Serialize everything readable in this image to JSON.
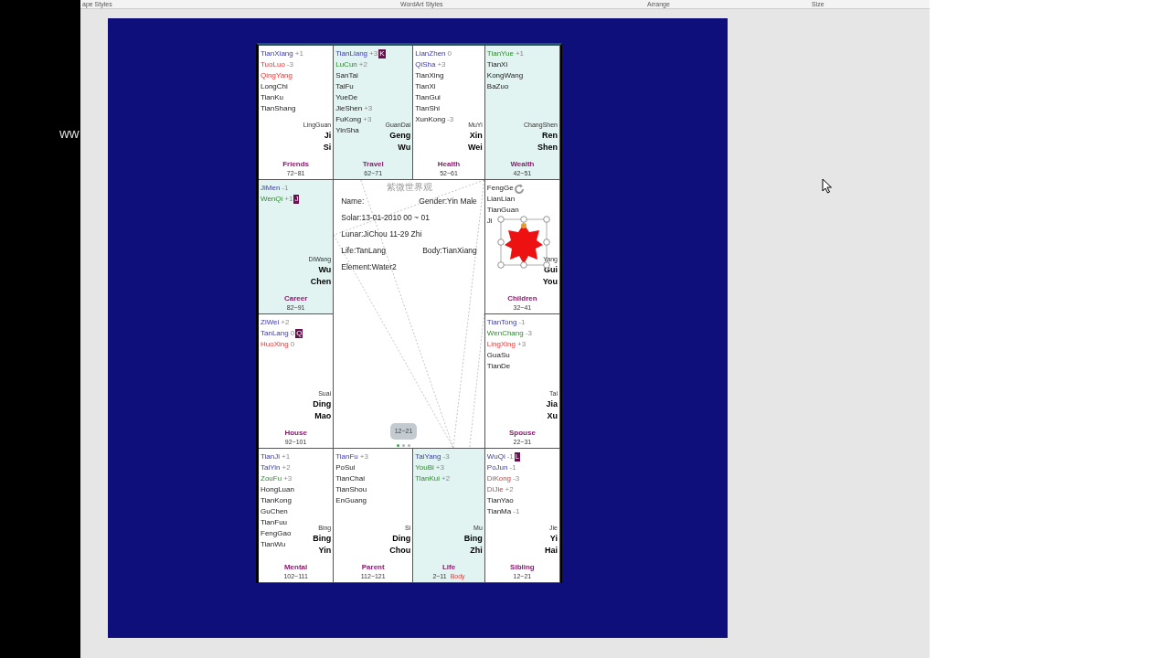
{
  "ribbon": {
    "groups": [
      "ape Styles",
      "WordArt Styles",
      "Arrange",
      "Size"
    ]
  },
  "side_text": "ww",
  "chart": {
    "title": "紫微世界观",
    "info": [
      {
        "label": "Name:",
        "value": "Gender:Yin Male"
      },
      {
        "label": "Solar:13-01-2010 00 ~ 01"
      },
      {
        "label": "Lunar:JiChou 11-29 Zhi"
      },
      {
        "label": "Life:TanLang",
        "value": "Body:TianXiang"
      },
      {
        "label": "Element:Water2"
      }
    ],
    "decade_badge": "12~21",
    "pager": [
      {
        "selected": true
      },
      {
        "selected": false
      },
      {
        "selected": false
      }
    ],
    "palaces": [
      {
        "name": "Friends",
        "ages": "72~81",
        "highlighted": false,
        "minor": "LingGuan",
        "stem": "Ji",
        "branch": "Si",
        "stars": [
          {
            "name": "TianXiang",
            "brightness": "+1",
            "kind": "major"
          },
          {
            "name": "TuoLuo",
            "brightness": "-3",
            "kind": "malefic"
          },
          {
            "name": "QingYang",
            "kind": "malefic"
          },
          {
            "name": "LongChi",
            "kind": "minor"
          },
          {
            "name": "TianKu",
            "kind": "minor"
          },
          {
            "name": "TianShang",
            "kind": "minor"
          }
        ]
      },
      {
        "name": "Travel",
        "ages": "62~71",
        "highlighted": true,
        "minor": "GuanDai",
        "stem": "Geng",
        "branch": "Wu",
        "stars": [
          {
            "name": "TianLiang",
            "brightness": "+3",
            "kind": "major",
            "tag": "K"
          },
          {
            "name": "LuCun",
            "brightness": "+2",
            "kind": "auxiliary"
          },
          {
            "name": "SanTai",
            "kind": "minor"
          },
          {
            "name": "TaiFu",
            "kind": "minor"
          },
          {
            "name": "YueDe",
            "kind": "minor"
          },
          {
            "name": "JieShen",
            "brightness": "+3",
            "kind": "minor"
          },
          {
            "name": "FuKong",
            "brightness": "+3",
            "kind": "minor"
          },
          {
            "name": "YinSha",
            "kind": "minor"
          }
        ]
      },
      {
        "name": "Health",
        "ages": "52~61",
        "highlighted": false,
        "minor": "MuYi",
        "stem": "Xin",
        "branch": "Wei",
        "stars": [
          {
            "name": "LianZhen",
            "brightness": "0",
            "kind": "major"
          },
          {
            "name": "QiSha",
            "brightness": "+3",
            "kind": "major"
          },
          {
            "name": "TianXing",
            "kind": "minor"
          },
          {
            "name": "TianXi",
            "kind": "minor"
          },
          {
            "name": "TianGui",
            "kind": "minor"
          },
          {
            "name": "TianShi",
            "kind": "minor"
          },
          {
            "name": "XunKong",
            "brightness": "-3",
            "kind": "minor"
          }
        ]
      },
      {
        "name": "Wealth",
        "ages": "42~51",
        "highlighted": true,
        "minor": "ChangShen",
        "stem": "Ren",
        "branch": "Shen",
        "stars": [
          {
            "name": "TianYue",
            "brightness": "+1",
            "kind": "auxiliary"
          },
          {
            "name": "TianXi",
            "kind": "minor"
          },
          {
            "name": "KongWang",
            "kind": "minor"
          },
          {
            "name": "BaZuo",
            "kind": "minor"
          }
        ]
      },
      {
        "name": "Career",
        "ages": "82~91",
        "highlighted": true,
        "minor": "DiWang",
        "stem": "Wu",
        "branch": "Chen",
        "stars": [
          {
            "name": "JiMen",
            "brightness": "-1",
            "kind": "major"
          },
          {
            "name": "WenQi",
            "brightness": "+1",
            "kind": "auxiliary",
            "tag": "J"
          }
        ]
      },
      {
        "name": "Children",
        "ages": "32~41",
        "highlighted": false,
        "minor": "Yang",
        "stem": "Gui",
        "branch": "You",
        "selected_shape": true,
        "stars": [
          {
            "name": "FengGe",
            "kind": "minor"
          },
          {
            "name": "LianLian",
            "kind": "minor"
          },
          {
            "name": "TianGuan",
            "kind": "minor"
          },
          {
            "name": "Ji",
            "kind": "minor"
          }
        ]
      },
      {
        "name": "House",
        "ages": "92~101",
        "highlighted": false,
        "minor": "Suai",
        "stem": "Ding",
        "branch": "Mao",
        "stars": [
          {
            "name": "ZiWei",
            "brightness": "+2",
            "kind": "major"
          },
          {
            "name": "TanLang",
            "brightness": "0",
            "kind": "major",
            "tag": "Q"
          },
          {
            "name": "HuoXing",
            "brightness": "0",
            "kind": "malefic"
          }
        ]
      },
      {
        "name": "Spouse",
        "ages": "22~31",
        "highlighted": false,
        "minor": "Tai",
        "stem": "Jia",
        "branch": "Xu",
        "stars": [
          {
            "name": "TianTong",
            "brightness": "-1",
            "kind": "major"
          },
          {
            "name": "WenChang",
            "brightness": "-3",
            "kind": "auxiliary"
          },
          {
            "name": "LingXing",
            "brightness": "+3",
            "kind": "malefic"
          },
          {
            "name": "GuaSu",
            "kind": "minor"
          },
          {
            "name": "TianDe",
            "kind": "minor"
          }
        ]
      },
      {
        "name": "Mental",
        "ages": "102~111",
        "highlighted": false,
        "minor": "Bing",
        "stem": "Bing",
        "branch": "Yin",
        "stars": [
          {
            "name": "TianJi",
            "brightness": "+1",
            "kind": "major"
          },
          {
            "name": "TaiYin",
            "brightness": "+2",
            "kind": "major"
          },
          {
            "name": "ZouFu",
            "brightness": "+3",
            "kind": "auxiliary"
          },
          {
            "name": "HongLuan",
            "kind": "minor"
          },
          {
            "name": "TianKong",
            "kind": "minor"
          },
          {
            "name": "GuChen",
            "kind": "minor"
          },
          {
            "name": "TianFuu",
            "kind": "minor"
          },
          {
            "name": "FengGao",
            "kind": "minor"
          },
          {
            "name": "TianWu",
            "kind": "minor"
          }
        ]
      },
      {
        "name": "Parent",
        "ages": "112~121",
        "highlighted": false,
        "minor": "Si",
        "stem": "Ding",
        "branch": "Chou",
        "stars": [
          {
            "name": "TianFu",
            "brightness": "+3",
            "kind": "major"
          },
          {
            "name": "PoSui",
            "kind": "minor"
          },
          {
            "name": "TianChai",
            "kind": "minor"
          },
          {
            "name": "TianShou",
            "kind": "minor"
          },
          {
            "name": "EnGuang",
            "kind": "minor"
          }
        ]
      },
      {
        "name": "Life",
        "ages": "2~11",
        "highlighted": true,
        "body_label": "Body",
        "minor": "Mu",
        "stem": "Bing",
        "branch": "Zhi",
        "stars": [
          {
            "name": "TaiYang",
            "brightness": "-3",
            "kind": "major"
          },
          {
            "name": "YouBi",
            "brightness": "+3",
            "kind": "auxiliary"
          },
          {
            "name": "TianKui",
            "brightness": "+2",
            "kind": "auxiliary"
          }
        ]
      },
      {
        "name": "Sibling",
        "ages": "12~21",
        "highlighted": false,
        "minor": "Jie",
        "stem": "Yi",
        "branch": "Hai",
        "stars": [
          {
            "name": "WuQi",
            "brightness": "-1",
            "kind": "major",
            "tag": "L"
          },
          {
            "name": "PoJun",
            "brightness": "-1",
            "kind": "major"
          },
          {
            "name": "DiKong",
            "brightness": "-3",
            "kind": "malefic"
          },
          {
            "name": "DiJie",
            "brightness": "+2",
            "kind": "malefic"
          },
          {
            "name": "TianYao",
            "kind": "minor"
          },
          {
            "name": "TianMa",
            "brightness": "-1",
            "kind": "minor"
          }
        ]
      }
    ]
  }
}
